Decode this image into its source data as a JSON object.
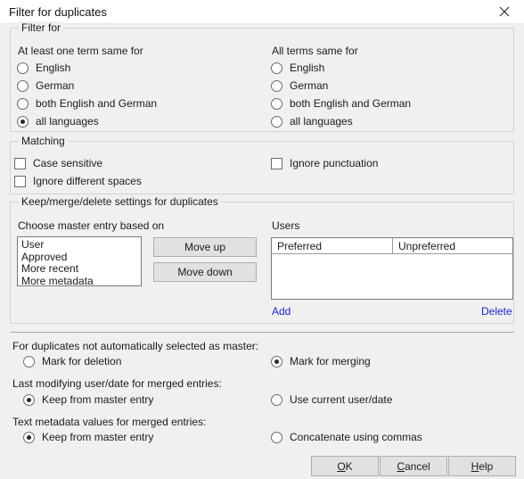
{
  "window": {
    "title": "Filter for duplicates",
    "close_icon": "close-icon"
  },
  "filter_for": {
    "group_title": "Filter for",
    "left": {
      "heading": "At least one term same for",
      "options": [
        {
          "label": "English",
          "selected": false
        },
        {
          "label": "German",
          "selected": false
        },
        {
          "label": "both English and German",
          "selected": false
        },
        {
          "label": "all languages",
          "selected": true
        }
      ]
    },
    "right": {
      "heading": "All terms same for",
      "options": [
        {
          "label": "English",
          "selected": false
        },
        {
          "label": "German",
          "selected": false
        },
        {
          "label": "both English and German",
          "selected": false
        },
        {
          "label": "all languages",
          "selected": false
        }
      ]
    }
  },
  "matching": {
    "group_title": "Matching",
    "left": [
      {
        "label": "Case sensitive",
        "checked": false
      },
      {
        "label": "Ignore different spaces",
        "checked": false
      }
    ],
    "right": [
      {
        "label": "Ignore punctuation",
        "checked": false
      }
    ]
  },
  "keep_merge": {
    "group_title": "Keep/merge/delete settings for duplicates",
    "master_label": "Choose master entry based on",
    "master_items": [
      "User",
      "Approved",
      "More recent",
      "More metadata"
    ],
    "move_up_label": "Move up",
    "move_down_label": "Move down",
    "users_label": "Users",
    "users_columns": [
      "Preferred",
      "Unpreferred"
    ],
    "users_rows": [],
    "add_label": "Add",
    "delete_label": "Delete"
  },
  "options": {
    "duplicates": {
      "heading": "For duplicates not automatically selected as master:",
      "left": {
        "label": "Mark for deletion",
        "selected": false
      },
      "right": {
        "label": "Mark for merging",
        "selected": true
      }
    },
    "last_modifying": {
      "heading": "Last modifying user/date for merged entries:",
      "left": {
        "label": "Keep from master entry",
        "selected": true
      },
      "right": {
        "label": "Use current user/date",
        "selected": false
      }
    },
    "text_metadata": {
      "heading": "Text metadata values for merged entries:",
      "left": {
        "label": "Keep from master entry",
        "selected": true
      },
      "right": {
        "label": "Concatenate using commas",
        "selected": false
      }
    }
  },
  "buttons": {
    "ok": {
      "pre": "",
      "acc": "O",
      "post": "K"
    },
    "cancel": {
      "pre": "",
      "acc": "C",
      "post": "ancel"
    },
    "help": {
      "pre": "",
      "acc": "H",
      "post": "elp"
    }
  },
  "colors": {
    "background": "#f0f0f0",
    "titlebar": "#ffffff",
    "link": "#2222cc",
    "button_face": "#e1e1e1"
  }
}
